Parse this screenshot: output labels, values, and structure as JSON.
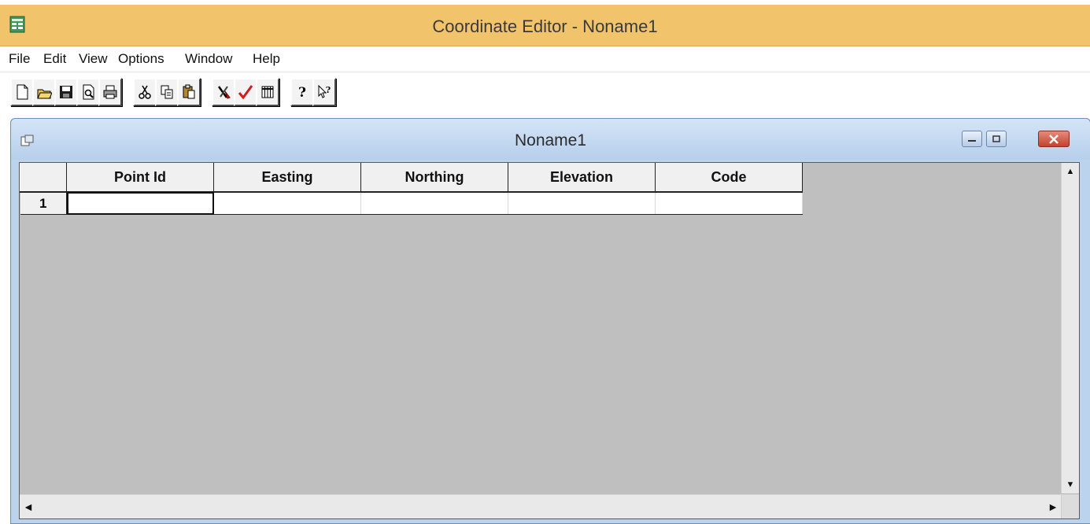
{
  "window": {
    "title": "Coordinate Editor - Noname1",
    "menu": [
      "File",
      "Edit",
      "View",
      "Options",
      "Window",
      "Help"
    ],
    "toolbar_icons": [
      "new-icon",
      "open-icon",
      "save-icon",
      "print-preview-icon",
      "print-icon",
      "cut-icon",
      "copy-icon",
      "paste-icon",
      "tools-icon",
      "check-icon",
      "table-icon",
      "help-icon",
      "context-help-icon"
    ],
    "colors": {
      "titlebar": "#f1c46c",
      "mdi_titlebar": "#bcd3ee",
      "grid_bg": "#bfbfbf",
      "close_button": "#c3422e"
    }
  },
  "document": {
    "title": "Noname1",
    "columns": [
      "Point Id",
      "Easting",
      "Northing",
      "Elevation",
      "Code"
    ],
    "rows": [
      {
        "row_number": "1",
        "cells": [
          "",
          "",
          "",
          "",
          ""
        ]
      }
    ]
  }
}
